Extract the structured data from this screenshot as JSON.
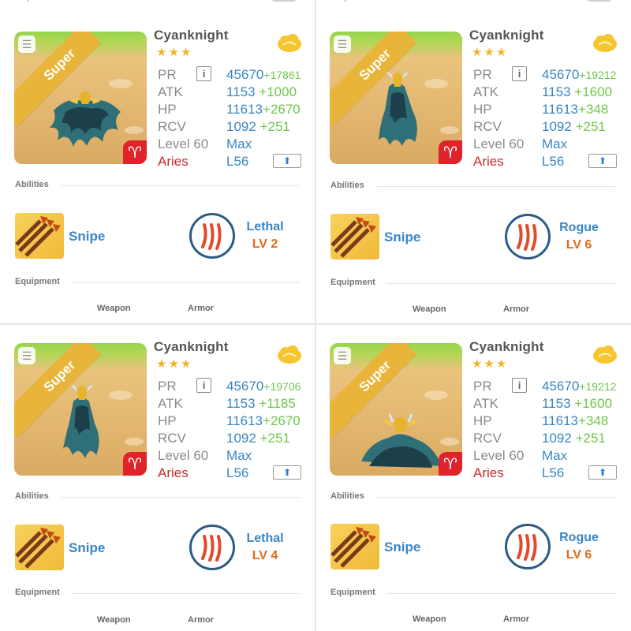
{
  "colors": {
    "accent_blue": "#3a86c4",
    "bonus_green": "#6ec64a",
    "star_gold": "#f0b62b",
    "element_red": "#cc2b2b",
    "level_orange": "#e06a1b",
    "ribbon_gold": "#e9b43a"
  },
  "icons": {
    "info": "i",
    "zodiac": "♈",
    "up": "⬆",
    "note": "☰"
  },
  "panels": [
    {
      "name": "Cyanknight",
      "stars": "★★★",
      "rarity": "Super",
      "stats": {
        "pr_label": "PR",
        "pr_value": "45670",
        "pr_bonus": "+17861",
        "atk_label": "ATK",
        "atk_value": "1153",
        "atk_bonus": "+1000",
        "hp_label": "HP",
        "hp_value": "11613",
        "hp_bonus": "+2670",
        "rcv_label": "RCV",
        "rcv_value": "1092",
        "rcv_bonus": "+251",
        "level_label": "Level 60",
        "level_value": "Max",
        "element_label": "Aries",
        "skill_level": "L56"
      },
      "abilities_title": "Abilities",
      "skill": "Snipe",
      "ability": {
        "name": "Lethal",
        "level": "LV 2"
      },
      "equipment_title": "Equipment",
      "equip": {
        "weapon": "Weapon",
        "armor": "Armor"
      }
    },
    {
      "name": "Cyanknight",
      "stars": "★★★",
      "rarity": "Super",
      "stats": {
        "pr_label": "PR",
        "pr_value": "45670",
        "pr_bonus": "+19212",
        "atk_label": "ATK",
        "atk_value": "1153",
        "atk_bonus": "+1600",
        "hp_label": "HP",
        "hp_value": "11613",
        "hp_bonus": "+348",
        "rcv_label": "RCV",
        "rcv_value": "1092",
        "rcv_bonus": "+251",
        "level_label": "Level 60",
        "level_value": "Max",
        "element_label": "Aries",
        "skill_level": "L56"
      },
      "abilities_title": "Abilities",
      "skill": "Snipe",
      "ability": {
        "name": "Rogue",
        "level": "LV 6"
      },
      "equipment_title": "Equipment",
      "equip": {
        "weapon": "Weapon",
        "armor": "Armor"
      }
    },
    {
      "name": "Cyanknight",
      "stars": "★★★",
      "rarity": "Super",
      "stats": {
        "pr_label": "PR",
        "pr_value": "45670",
        "pr_bonus": "+19706",
        "atk_label": "ATK",
        "atk_value": "1153",
        "atk_bonus": "+1185",
        "hp_label": "HP",
        "hp_value": "11613",
        "hp_bonus": "+2670",
        "rcv_label": "RCV",
        "rcv_value": "1092",
        "rcv_bonus": "+251",
        "level_label": "Level 60",
        "level_value": "Max",
        "element_label": "Aries",
        "skill_level": "L56"
      },
      "abilities_title": "Abilities",
      "skill": "Snipe",
      "ability": {
        "name": "Lethal",
        "level": "LV 4"
      },
      "equipment_title": "Equipment",
      "equip": {
        "weapon": "Weapon",
        "armor": "Armor"
      }
    },
    {
      "name": "Cyanknight",
      "stars": "★★★",
      "rarity": "Super",
      "stats": {
        "pr_label": "PR",
        "pr_value": "45670",
        "pr_bonus": "+19212",
        "atk_label": "ATK",
        "atk_value": "1153",
        "atk_bonus": "+1600",
        "hp_label": "HP",
        "hp_value": "11613",
        "hp_bonus": "+348",
        "rcv_label": "RCV",
        "rcv_value": "1092",
        "rcv_bonus": "+251",
        "level_label": "Level 60",
        "level_value": "Max",
        "element_label": "Aries",
        "skill_level": "L56"
      },
      "abilities_title": "Abilities",
      "skill": "Snipe",
      "ability": {
        "name": "Rogue",
        "level": "LV 6"
      },
      "equipment_title": "Equipment",
      "equip": {
        "weapon": "Weapon",
        "armor": "Armor"
      }
    }
  ]
}
